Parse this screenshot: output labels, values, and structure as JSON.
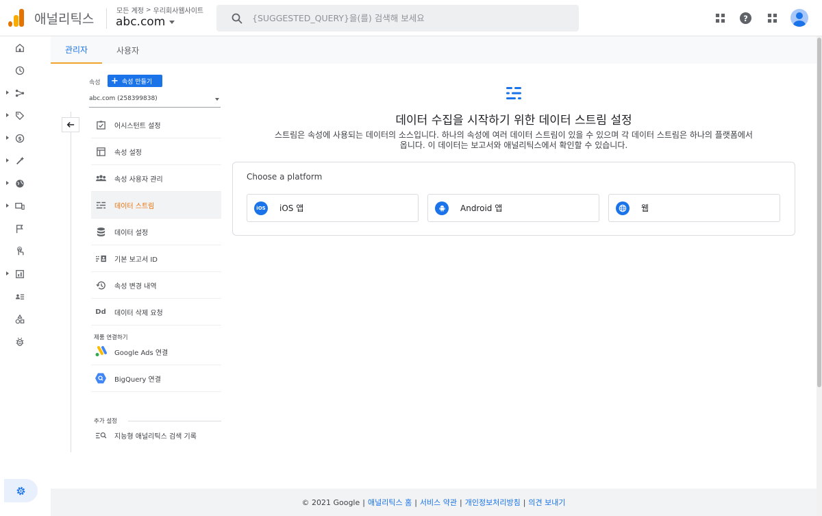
{
  "header": {
    "brand": "애널리틱스",
    "breadcrumb": {
      "all_accounts": "모든 계정",
      "separator": ">",
      "account": "우리회사웹사이트"
    },
    "property": "abc.com",
    "search_placeholder": "{SUGGESTED_QUERY}을(를) 검색해 보세요",
    "icons": [
      "apps-grid-icon",
      "help-icon",
      "apps-icon",
      "account-avatar"
    ]
  },
  "rail": {
    "items": [
      "home-icon",
      "reports-icon",
      "explore-icon",
      "tag-icon",
      "monetization-icon",
      "magic-icon",
      "globe-icon",
      "devices-icon",
      "flag-icon",
      "touch-icon",
      "analysis-icon",
      "audience-icon",
      "shapes-icon",
      "debug-icon"
    ],
    "settings_icon": "settings-gear-icon"
  },
  "tabs": [
    {
      "label": "관리자",
      "active": true
    },
    {
      "label": "사용자",
      "active": false
    }
  ],
  "property_panel": {
    "label": "속성",
    "create_button": "속성 만들기",
    "selected_property": "abc.com (258399838)",
    "menu": [
      {
        "label": "어시스턴트 설정",
        "icon": "checklist-icon",
        "active": false
      },
      {
        "label": "속성 설정",
        "icon": "property-layout-icon",
        "active": false
      },
      {
        "label": "속성 사용자 관리",
        "icon": "people-icon",
        "active": false
      },
      {
        "label": "데이터 스트림",
        "icon": "data-stream-icon",
        "active": true
      },
      {
        "label": "데이터 설정",
        "icon": "database-icon",
        "active": false
      },
      {
        "label": "기본 보고서 ID",
        "icon": "report-id-icon",
        "active": false
      },
      {
        "label": "속성 변경 내역",
        "icon": "history-icon",
        "active": false
      },
      {
        "label": "데이터 삭제 요청",
        "icon": "dd-icon",
        "active": false
      }
    ],
    "product_links_label": "제품 연결하기",
    "product_links": [
      {
        "label": "Google Ads 연결",
        "icon": "google-ads-icon"
      },
      {
        "label": "BigQuery 연결",
        "icon": "bigquery-icon"
      }
    ],
    "additional_label": "추가 설정",
    "additional": [
      {
        "label": "지능형 애널리틱스 검색 기록",
        "icon": "search-history-icon"
      }
    ],
    "dd_text": "Dd"
  },
  "content": {
    "title": "데이터 수집을 시작하기 위한 데이터 스트림 설정",
    "description_line1": "스트림은 속성에 사용되는 데이터의 소스입니다. 하나의 속성에 여러 데이터 스트림이 있을 수 있으며 각 데이터 스트림은 하나의 플랫폼에서",
    "description_line2": "옵니다. 이 데이터는 보고서와 애널리틱스에서 확인할 수 있습니다.",
    "platform_heading": "Choose a platform",
    "platforms": [
      {
        "label": "iOS 앱",
        "icon_text": "iOS"
      },
      {
        "label": "Android 앱",
        "icon_text": ""
      },
      {
        "label": "웹",
        "icon_text": ""
      }
    ]
  },
  "footer": {
    "copyright": "© 2021 Google",
    "links": [
      "애널리틱스 홈",
      "서비스 약관",
      "개인정보처리방침",
      "의견 보내기"
    ],
    "separator": "|"
  },
  "colors": {
    "accent_blue": "#1a73e8",
    "active_orange": "#e8710a",
    "tab_underline": "#f0a32c"
  }
}
